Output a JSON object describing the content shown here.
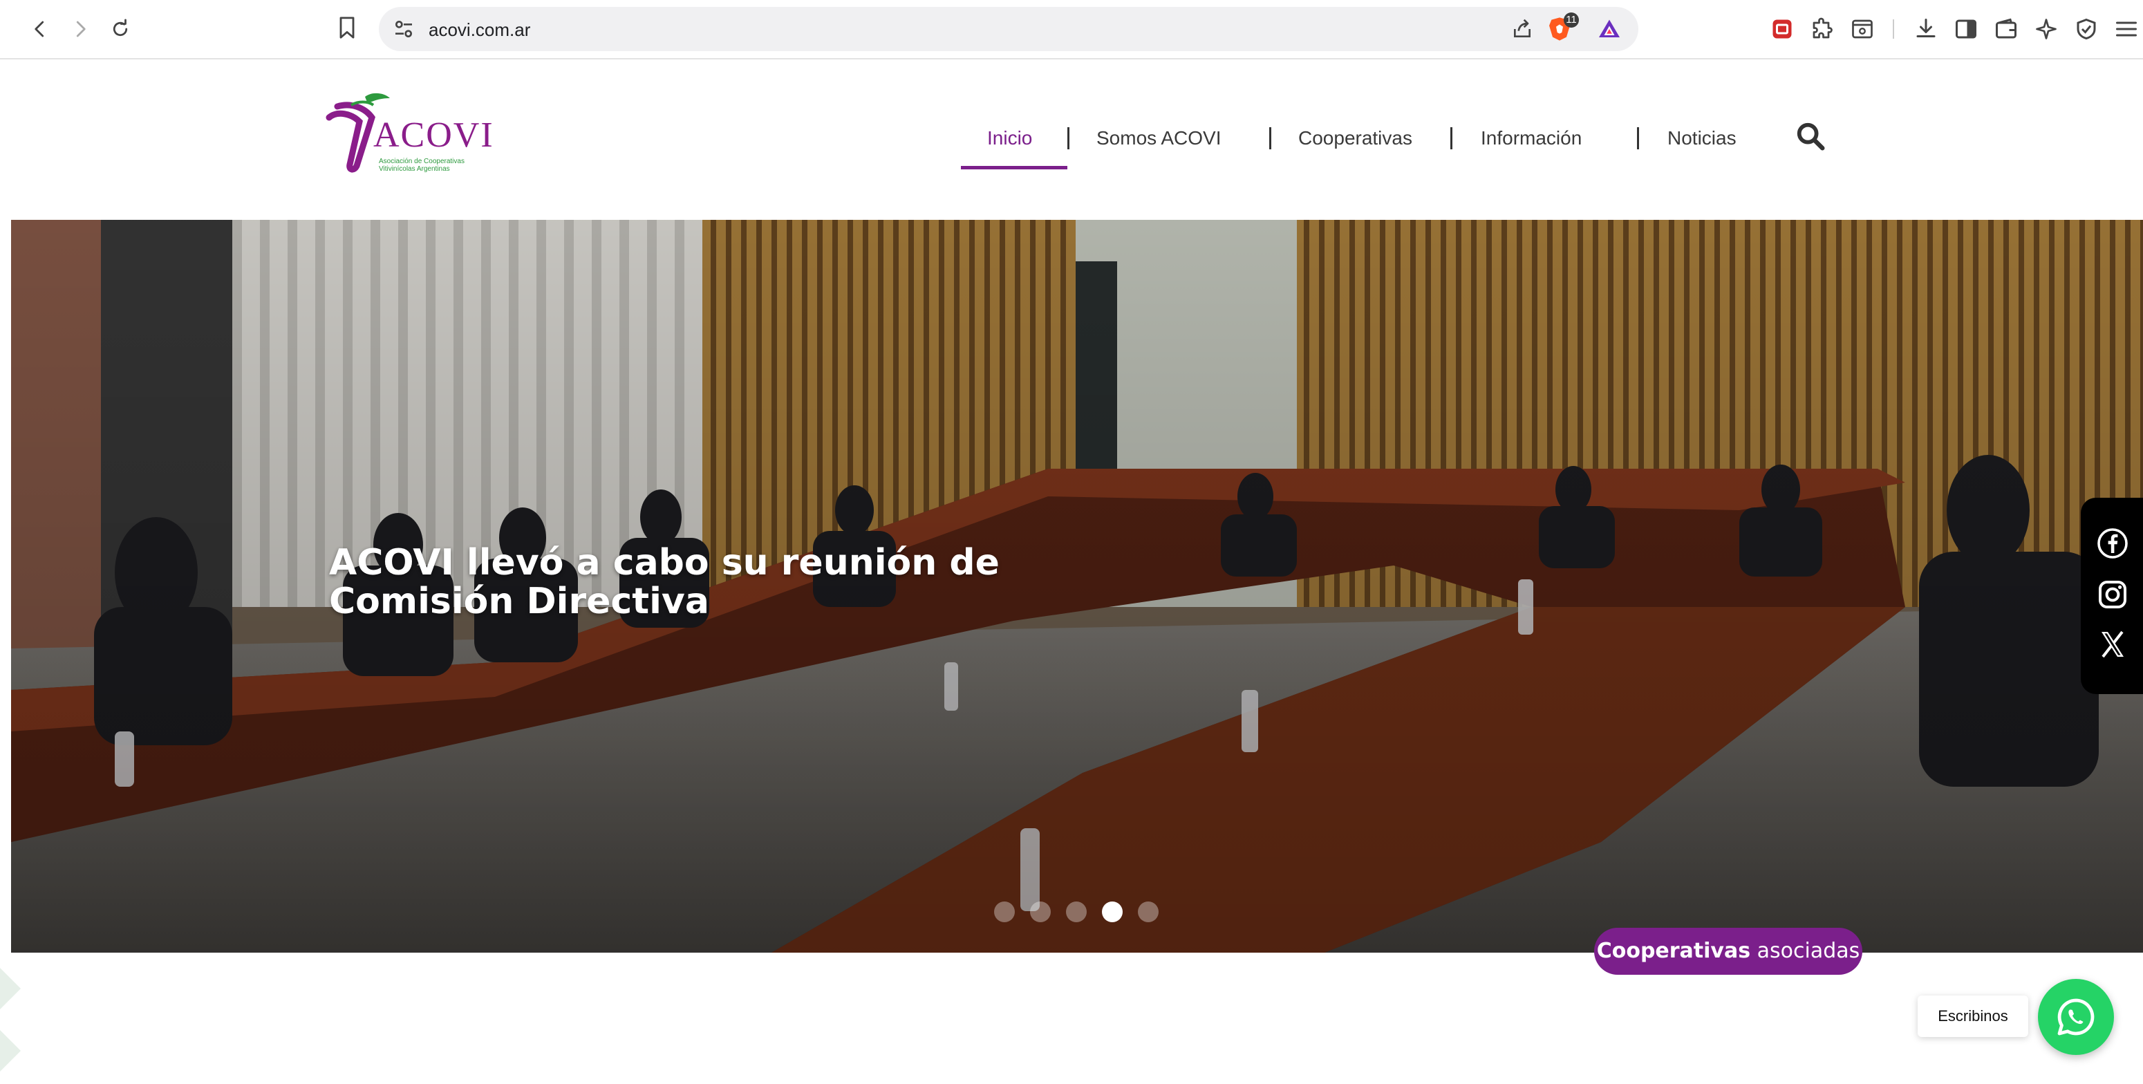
{
  "browser": {
    "url": "acovi.com.ar",
    "brave_badge_count": "11"
  },
  "logo": {
    "wordmark": "ACOVI",
    "tagline": "Asociación de Cooperativas Vitivinícolas Argentinas"
  },
  "nav": {
    "items": [
      "Inicio",
      "Somos ACOVI",
      "Cooperativas",
      "Información",
      "Noticias"
    ],
    "active": "Inicio"
  },
  "hero": {
    "slides_count": 5,
    "active_slide": 4,
    "headline_line1": "ACOVI llevó a cabo su reunión de",
    "headline_line2": "Comisión Directiva"
  },
  "social": {
    "icons": [
      "facebook-icon",
      "instagram-icon",
      "x-icon"
    ]
  },
  "floating": {
    "coop_bold": "Cooperativas",
    "coop_rest": " asociadas",
    "chat_label": "Escribinos"
  },
  "colors": {
    "brand_purple": "#7b1f8b",
    "brand_green": "#2d9a3e",
    "whatsapp_green": "#25d366"
  }
}
